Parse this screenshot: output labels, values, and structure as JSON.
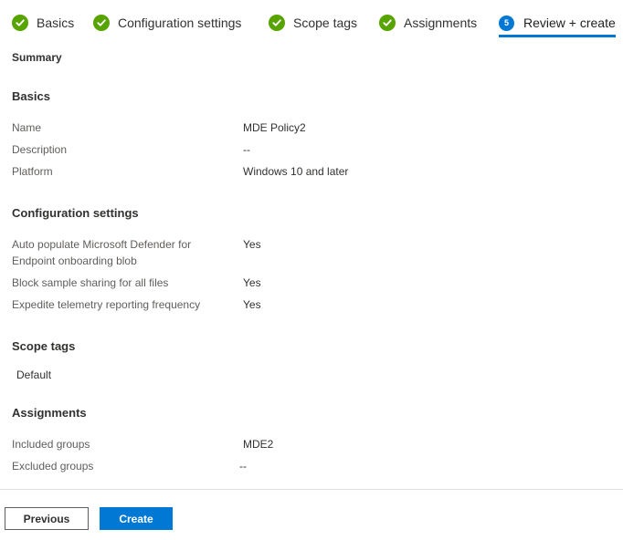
{
  "wizard": {
    "steps": [
      {
        "label": "Basics",
        "status": "complete"
      },
      {
        "label": "Configuration settings",
        "status": "complete"
      },
      {
        "label": "Scope tags",
        "status": "complete"
      },
      {
        "label": "Assignments",
        "status": "complete"
      },
      {
        "label": "Review + create",
        "status": "current",
        "number": "5"
      }
    ]
  },
  "summary": {
    "title": "Summary",
    "basics": {
      "heading": "Basics",
      "rows": [
        {
          "label": "Name",
          "value": "MDE Policy2"
        },
        {
          "label": "Description",
          "value": "--"
        },
        {
          "label": "Platform",
          "value": "Windows 10 and later"
        }
      ]
    },
    "configuration": {
      "heading": "Configuration settings",
      "rows": [
        {
          "label_line1": "Auto populate Microsoft Defender for",
          "label_line2": "Endpoint onboarding blob",
          "value": "Yes"
        },
        {
          "label": "Block sample sharing for all files",
          "value": "Yes"
        },
        {
          "label": "Expedite telemetry reporting frequency",
          "value": "Yes"
        }
      ]
    },
    "scope_tags": {
      "heading": "Scope tags",
      "value": "Default"
    },
    "assignments": {
      "heading": "Assignments",
      "rows": [
        {
          "label": "Included groups",
          "value": "MDE2"
        },
        {
          "label": "Excluded groups",
          "value": "--"
        }
      ]
    }
  },
  "footer": {
    "previous_label": "Previous",
    "create_label": "Create"
  },
  "colors": {
    "accent": "#0078d4",
    "success": "#57a300"
  },
  "icons": {
    "complete": "checkmark-circle-icon",
    "current": "step-number-circle"
  }
}
